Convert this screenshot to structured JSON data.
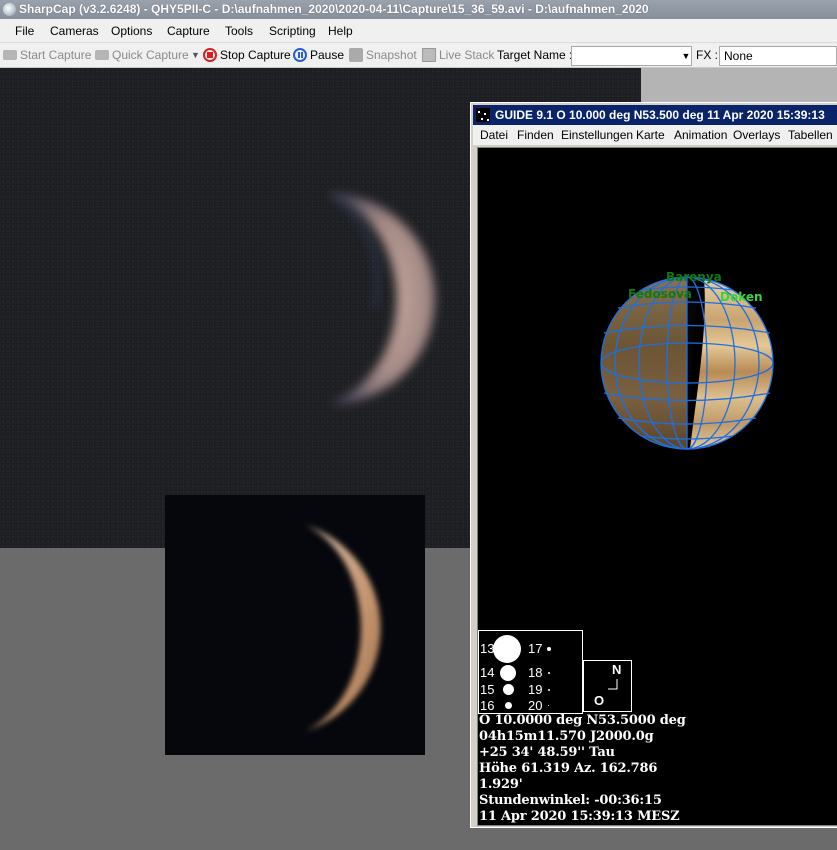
{
  "window": {
    "title": "SharpCap (v3.2.6248) - QHY5PII-C - D:\\aufnahmen_2020\\2020-04-11\\Capture\\15_36_59.avi - D:\\aufnahmen_2020"
  },
  "menu": [
    "File",
    "Cameras",
    "Options",
    "Capture",
    "Tools",
    "Scripting",
    "Help"
  ],
  "toolbar": {
    "start_capture": "Start Capture",
    "quick_capture": "Quick Capture",
    "stop_capture": "Stop Capture",
    "pause": "Pause",
    "snapshot": "Snapshot",
    "live_stack": "Live Stack",
    "target_name_label": "Target Name :",
    "target_name_value": "",
    "fx_label": "FX :",
    "fx_value": "None"
  },
  "guide": {
    "title": "GUIDE 9.1    O 10.000 deg N53.500 deg     11 Apr 2020 15:39:13",
    "menu": [
      "Datei",
      "Finden",
      "Einstellungen",
      "Karte",
      "Animation",
      "Overlays",
      "Tabellen"
    ],
    "features": {
      "barenya": "Barenya",
      "fedosova": "Fedosova",
      "doken": "Doken"
    },
    "magnitudes": [
      "13",
      "14",
      "15",
      "16",
      "17",
      "18",
      "19",
      "20"
    ],
    "compass": {
      "n": "N",
      "o": "O"
    },
    "info_lines": [
      "O 10.0000 deg N53.5000 deg",
      "04h15m11.570 J2000.0g",
      "+25 34' 48.59''   Tau",
      "Höhe 61.319  Az. 162.786",
      "1.929'",
      "Stundenwinkel: -00:36:15",
      "11 Apr 2020 15:39:13 MESZ"
    ]
  }
}
